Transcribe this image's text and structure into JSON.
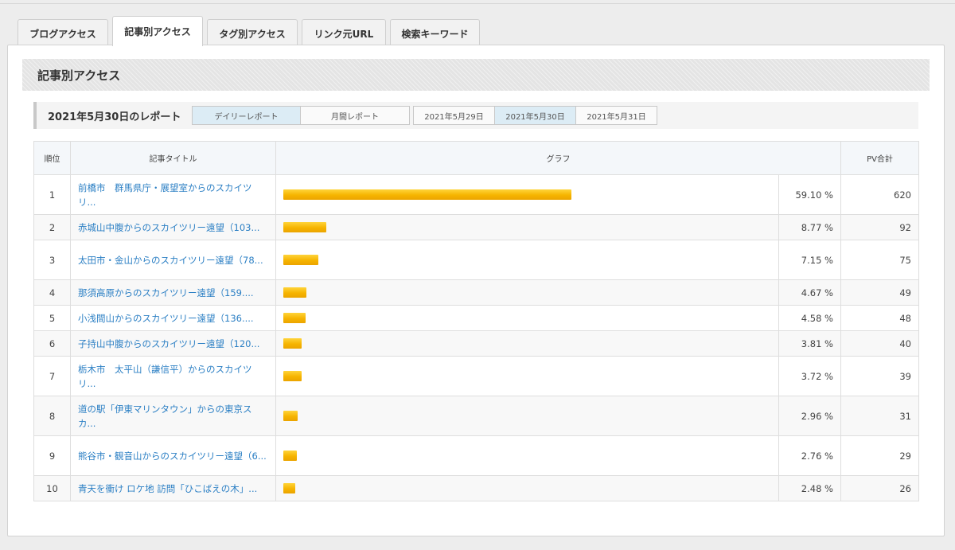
{
  "tabs": [
    {
      "label": "ブログアクセス",
      "active": false
    },
    {
      "label": "記事別アクセス",
      "active": true
    },
    {
      "label": "タグ別アクセス",
      "active": false
    },
    {
      "label": "リンク元URL",
      "active": false
    },
    {
      "label": "検索キーワード",
      "active": false
    }
  ],
  "section": {
    "title": "記事別アクセス"
  },
  "report": {
    "title": "2021年5月30日のレポート",
    "daily_label": "デイリーレポート",
    "monthly_label": "月間レポート",
    "dates": [
      "2021年5月29日",
      "2021年5月30日",
      "2021年5月31日"
    ],
    "selected_date": "2021年5月30日"
  },
  "table": {
    "headers": {
      "rank": "順位",
      "title": "記事タイトル",
      "graph": "グラフ",
      "pv": "PV合計"
    },
    "rows": [
      {
        "rank": "1",
        "title": "前橋市　群馬県庁・展望室からのスカイツリ...",
        "share": 59.1,
        "percent": "59.10 %",
        "pv": "620"
      },
      {
        "rank": "2",
        "title": "赤城山中腹からのスカイツリー遠望（103...",
        "share": 8.77,
        "percent": "8.77 %",
        "pv": "92"
      },
      {
        "rank": "3",
        "title": "太田市・金山からのスカイツリー遠望（78...",
        "share": 7.15,
        "percent": "7.15 %",
        "pv": "75"
      },
      {
        "rank": "4",
        "title": "那須高原からのスカイツリー遠望（159....",
        "share": 4.67,
        "percent": "4.67 %",
        "pv": "49"
      },
      {
        "rank": "5",
        "title": "小浅間山からのスカイツリー遠望（136....",
        "share": 4.58,
        "percent": "4.58 %",
        "pv": "48"
      },
      {
        "rank": "6",
        "title": "子持山中腹からのスカイツリー遠望（120...",
        "share": 3.81,
        "percent": "3.81 %",
        "pv": "40"
      },
      {
        "rank": "7",
        "title": "栃木市　太平山（謙信平）からのスカイツリ...",
        "share": 3.72,
        "percent": "3.72 %",
        "pv": "39"
      },
      {
        "rank": "8",
        "title": "道の駅「伊東マリンタウン」からの東京スカ...",
        "share": 2.96,
        "percent": "2.96 %",
        "pv": "31"
      },
      {
        "rank": "9",
        "title": "熊谷市・観音山からのスカイツリー遠望（6...",
        "share": 2.76,
        "percent": "2.76 %",
        "pv": "29"
      },
      {
        "rank": "10",
        "title": "青天を衝け ロケ地 訪問「ひこばえの木」...",
        "share": 2.48,
        "percent": "2.48 %",
        "pv": "26"
      }
    ]
  }
}
